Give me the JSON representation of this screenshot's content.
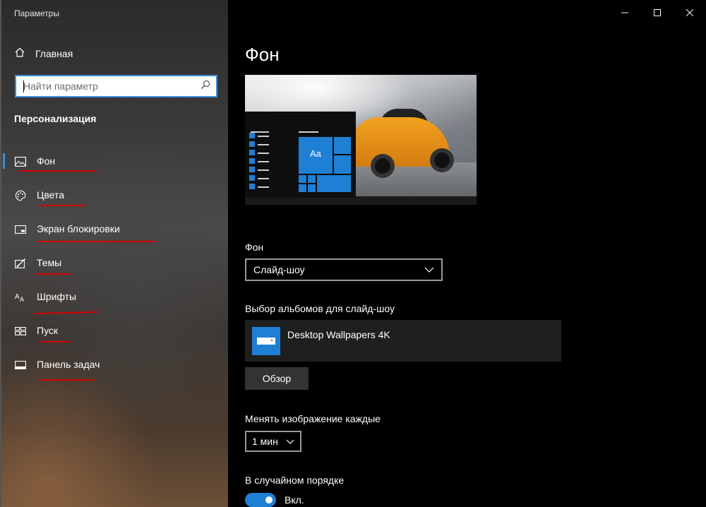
{
  "window": {
    "title": "Параметры"
  },
  "sidebar": {
    "home_label": "Главная",
    "search_placeholder": "Найти параметр",
    "section_title": "Персонализация",
    "items": [
      {
        "label": "Фон",
        "icon": "picture-icon",
        "active": true
      },
      {
        "label": "Цвета",
        "icon": "palette-icon",
        "active": false
      },
      {
        "label": "Экран блокировки",
        "icon": "lock-screen-icon",
        "active": false
      },
      {
        "label": "Темы",
        "icon": "themes-icon",
        "active": false
      },
      {
        "label": "Шрифты",
        "icon": "fonts-icon",
        "active": false
      },
      {
        "label": "Пуск",
        "icon": "start-icon",
        "active": false
      },
      {
        "label": "Панель задач",
        "icon": "taskbar-icon",
        "active": false
      }
    ]
  },
  "main": {
    "title": "Фон",
    "preview_tile_text": "Aa",
    "background_label": "Фон",
    "background_value": "Слайд-шоу",
    "albums_label": "Выбор альбомов для слайд-шоу",
    "album_name": "Desktop Wallpapers 4K",
    "browse_label": "Обзор",
    "interval_label": "Менять изображение каждые",
    "interval_value": "1 мин",
    "shuffle_label": "В случайном порядке",
    "shuffle_state": "Вкл."
  },
  "colors": {
    "accent": "#1f7fd4",
    "annotation": "#d40000"
  }
}
